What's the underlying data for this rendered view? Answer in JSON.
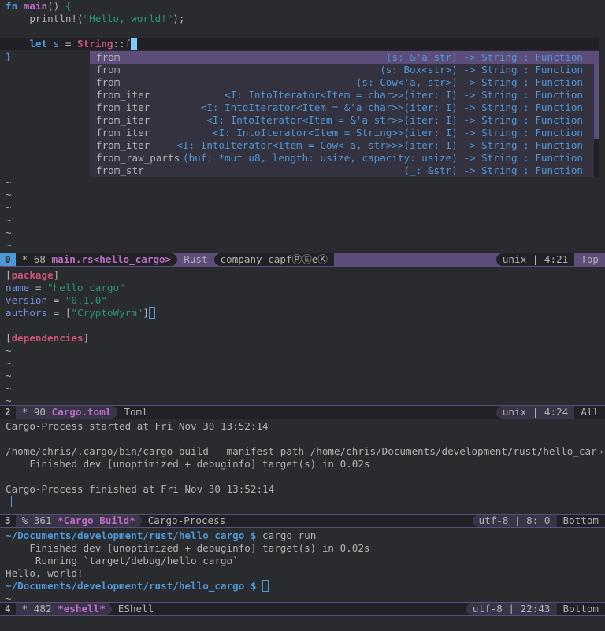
{
  "colors": {
    "background": "#292b2e",
    "modeline_active": "#5d4d7a",
    "keyword": "#4f97d7",
    "function": "#bc6ec5",
    "string": "#2d9574",
    "type": "#ce537a",
    "cursor": "#7ecbf5"
  },
  "editor": {
    "lines": [
      [
        [
          "fn",
          "kw"
        ],
        [
          " ",
          ""
        ],
        [
          "main",
          "fnn"
        ],
        [
          "() ",
          ""
        ],
        [
          "{",
          "str"
        ]
      ],
      [
        [
          "    println!(",
          ""
        ],
        [
          "\"Hello, world!\"",
          "str"
        ],
        [
          ");",
          ""
        ]
      ],
      [],
      [
        [
          "    ",
          ""
        ],
        [
          "let",
          "kw"
        ],
        [
          " ",
          ""
        ],
        [
          "s",
          "var"
        ],
        [
          " = ",
          ""
        ],
        [
          "String",
          "type"
        ],
        [
          "::f",
          ""
        ]
      ],
      [
        [
          "}",
          "kw"
        ]
      ],
      [],
      [],
      [],
      [],
      [],
      [],
      [],
      [],
      [],
      [
        [
          "~",
          "tilde"
        ]
      ],
      [
        [
          "~",
          "tilde"
        ]
      ],
      [
        [
          "~",
          "tilde"
        ]
      ],
      [
        [
          "~",
          "tilde"
        ]
      ],
      [
        [
          "~",
          "tilde"
        ]
      ],
      [
        [
          "~",
          "tilde"
        ]
      ]
    ],
    "current_line": 3
  },
  "completion": {
    "selected": 0,
    "items": [
      {
        "name": "from",
        "annotation": "(s: &'a str) -> String : Function"
      },
      {
        "name": "from",
        "annotation": "(s: Box<str>) -> String : Function"
      },
      {
        "name": "from",
        "annotation": "(s: Cow<'a, str>) -> String : Function"
      },
      {
        "name": "from_iter",
        "annotation": "<I: IntoIterator<Item = char>>(iter: I) -> String : Function"
      },
      {
        "name": "from_iter",
        "annotation": "<I: IntoIterator<Item = &'a char>>(iter: I) -> String : Function"
      },
      {
        "name": "from_iter",
        "annotation": "<I: IntoIterator<Item = &'a str>>(iter: I) -> String : Function"
      },
      {
        "name": "from_iter",
        "annotation": "<I: IntoIterator<Item = String>>(iter: I) -> String : Function"
      },
      {
        "name": "from_iter",
        "annotation": "<I: IntoIterator<Item = Cow<'a, str>>>(iter: I) -> String : Function"
      },
      {
        "name": "from_raw_parts",
        "annotation": "(buf: *mut u8, length: usize, capacity: usize) -> String : Function"
      },
      {
        "name": "from_str",
        "annotation": "(_: &str) -> String : Function"
      }
    ]
  },
  "modeline1": {
    "num": "0",
    "flag": "*",
    "size": "68",
    "buffer": "main.rs<hello_cargo>",
    "mode": "Rust",
    "minor": "company-capfⓅⒺeⓀ",
    "encoding": "unix | 4:21",
    "position": "Top"
  },
  "toml": {
    "lines": [
      [
        [
          "[",
          ""
        ],
        [
          "package",
          "sect"
        ],
        [
          "]",
          ""
        ]
      ],
      [
        [
          "name",
          "var"
        ],
        [
          " = ",
          ""
        ],
        [
          "\"hello_cargo\"",
          "str"
        ]
      ],
      [
        [
          "version",
          "var"
        ],
        [
          " = ",
          ""
        ],
        [
          "\"0.1.0\"",
          "str"
        ]
      ],
      [
        [
          "authors",
          "var"
        ],
        [
          " = [",
          ""
        ],
        [
          "\"CryptoWyrm\"",
          "str"
        ],
        [
          "]",
          ""
        ]
      ],
      [],
      [
        [
          "[",
          ""
        ],
        [
          "dependencies",
          "sect"
        ],
        [
          "]",
          ""
        ]
      ],
      [
        [
          "~",
          "tilde"
        ]
      ],
      [
        [
          "~",
          "tilde"
        ]
      ],
      [
        [
          "~",
          "tilde"
        ]
      ],
      [
        [
          "~",
          "tilde"
        ]
      ],
      [
        [
          "~",
          "tilde"
        ]
      ]
    ]
  },
  "modeline2": {
    "num": "2",
    "flag": "*",
    "size": "90",
    "buffer": "Cargo.toml",
    "mode": "Toml",
    "encoding": "unix | 4:24",
    "position": "All"
  },
  "build": {
    "lines": [
      [
        [
          "Cargo-Process started at Fri Nov 30 13:52:14",
          ""
        ]
      ],
      [],
      [
        [
          "/home/chris/.cargo/bin/cargo build --manifest-path /home/chris/Documents/development/rust/hello_car→",
          ""
        ]
      ],
      [
        [
          "    Finished dev [unoptimized + debuginfo] target(s) in 0.02s",
          ""
        ]
      ],
      [],
      [
        [
          "Cargo-Process finished at Fri Nov 30 13:52:14",
          ""
        ]
      ]
    ]
  },
  "modeline3": {
    "num": "3",
    "flag": "%",
    "size": "361",
    "buffer": "*Cargo Build*",
    "mode": "Cargo-Process",
    "encoding": "utf-8 | 8: 0",
    "position": "Bottom"
  },
  "eshell": {
    "lines": [
      [
        [
          "~/Documents/development/rust/hello_cargo $",
          "prompt"
        ],
        [
          " cargo run",
          ""
        ]
      ],
      [
        [
          "    Finished dev [unoptimized + debuginfo] target(s) in 0.02s",
          ""
        ]
      ],
      [
        [
          "     Running `target/debug/hello_cargo`",
          ""
        ]
      ],
      [
        [
          "Hello, world!",
          ""
        ]
      ],
      [
        [
          "~/Documents/development/rust/hello_cargo $",
          "prompt"
        ],
        [
          " ",
          ""
        ]
      ],
      [
        [
          "~",
          "tilde"
        ]
      ]
    ]
  },
  "modeline4": {
    "num": "4",
    "flag": "*",
    "size": "482",
    "buffer": "*eshell*",
    "mode": "EShell",
    "encoding": "utf-8 | 22:43",
    "position": "Bottom"
  }
}
